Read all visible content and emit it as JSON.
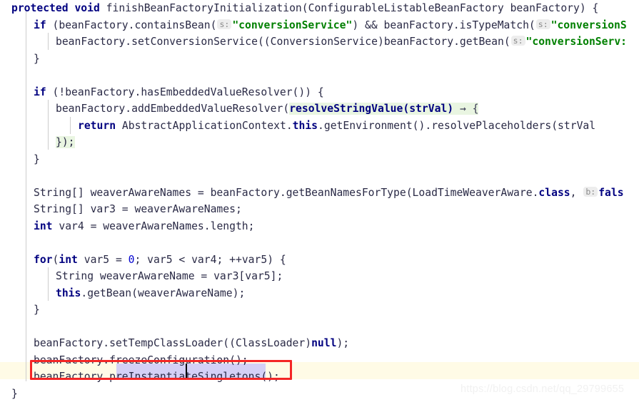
{
  "editor": {
    "language": "java",
    "colors": {
      "background": "#ffffff",
      "plain_text": "#2a2a46",
      "keyword": "#000080",
      "string": "#008000",
      "number": "#0000d0",
      "hint_text": "#8a8a8a",
      "hint_background": "#ededed",
      "lambda_highlight": "#e9f5e1",
      "current_line_highlight": "#fffbe6",
      "selection": "#d4d0f6",
      "indent_guide": "#cdcdcd",
      "annotation_border": "#f42626",
      "watermark": "#f1f1f1"
    },
    "lines": [
      {
        "n": 1,
        "indent": 0,
        "tokens": [
          {
            "t": "protected",
            "c": "kw"
          },
          {
            "t": " ",
            "c": "plain"
          },
          {
            "t": "void",
            "c": "kw"
          },
          {
            "t": " finishBeanFactoryInitialization(ConfigurableListableBeanFactory beanFactory) {",
            "c": "plain"
          }
        ]
      },
      {
        "n": 2,
        "indent": 1,
        "tokens": [
          {
            "t": "if",
            "c": "kw"
          },
          {
            "t": " (beanFactory.containsBean(",
            "c": "plain"
          },
          {
            "t": "s:",
            "c": "hint"
          },
          {
            "t": "\"conversionService\"",
            "c": "str"
          },
          {
            "t": ") && beanFactory.isTypeMatch(",
            "c": "plain"
          },
          {
            "t": "s:",
            "c": "hint"
          },
          {
            "t": "\"conversionS",
            "c": "str"
          }
        ]
      },
      {
        "n": 3,
        "indent": 2,
        "tokens": [
          {
            "t": "beanFactory.setConversionService((ConversionService)beanFactory.getBean(",
            "c": "plain"
          },
          {
            "t": "s:",
            "c": "hint"
          },
          {
            "t": "\"conversionServ:",
            "c": "str"
          }
        ]
      },
      {
        "n": 4,
        "indent": 1,
        "tokens": [
          {
            "t": "}",
            "c": "plain"
          }
        ]
      },
      {
        "n": 5,
        "indent": 0,
        "tokens": []
      },
      {
        "n": 6,
        "indent": 1,
        "tokens": [
          {
            "t": "if",
            "c": "kw"
          },
          {
            "t": " (!beanFactory.hasEmbeddedValueResolver()) {",
            "c": "plain"
          }
        ]
      },
      {
        "n": 7,
        "indent": 2,
        "tokens": [
          {
            "t": "beanFactory.addEmbeddedValueResolver(",
            "c": "plain"
          },
          {
            "t": "resolveStringValue(strVal)",
            "c": "lambda-sig"
          },
          {
            "t": " → {",
            "c": "lambda-arrow"
          }
        ]
      },
      {
        "n": 8,
        "indent": 3,
        "tokens": [
          {
            "t": "return",
            "c": "kw"
          },
          {
            "t": " AbstractApplicationContext.",
            "c": "plain"
          },
          {
            "t": "this",
            "c": "kw"
          },
          {
            "t": ".getEnvironment().resolvePlaceholders(strVal",
            "c": "plain"
          }
        ]
      },
      {
        "n": 9,
        "indent": 2,
        "tokens": [
          {
            "t": "});",
            "c": "lambda-close"
          }
        ]
      },
      {
        "n": 10,
        "indent": 1,
        "tokens": [
          {
            "t": "}",
            "c": "plain"
          }
        ]
      },
      {
        "n": 11,
        "indent": 0,
        "tokens": []
      },
      {
        "n": 12,
        "indent": 1,
        "tokens": [
          {
            "t": "String[] weaverAwareNames = beanFactory.getBeanNamesForType(LoadTimeWeaverAware.",
            "c": "plain"
          },
          {
            "t": "class",
            "c": "kw"
          },
          {
            "t": ", ",
            "c": "plain"
          },
          {
            "t": "b:",
            "c": "hint"
          },
          {
            "t": "fals",
            "c": "kw"
          }
        ]
      },
      {
        "n": 13,
        "indent": 1,
        "tokens": [
          {
            "t": "String[] var3 = weaverAwareNames;",
            "c": "plain"
          }
        ]
      },
      {
        "n": 14,
        "indent": 1,
        "tokens": [
          {
            "t": "int",
            "c": "kw"
          },
          {
            "t": " var4 = weaverAwareNames.length;",
            "c": "plain"
          }
        ]
      },
      {
        "n": 15,
        "indent": 0,
        "tokens": []
      },
      {
        "n": 16,
        "indent": 1,
        "tokens": [
          {
            "t": "for",
            "c": "kw"
          },
          {
            "t": "(",
            "c": "plain"
          },
          {
            "t": "int",
            "c": "kw"
          },
          {
            "t": " var5 = ",
            "c": "plain"
          },
          {
            "t": "0",
            "c": "num"
          },
          {
            "t": "; var5 < var4; ++var5) {",
            "c": "plain"
          }
        ]
      },
      {
        "n": 17,
        "indent": 2,
        "tokens": [
          {
            "t": "String weaverAwareName = var3[var5];",
            "c": "plain"
          }
        ]
      },
      {
        "n": 18,
        "indent": 2,
        "tokens": [
          {
            "t": "this",
            "c": "kw"
          },
          {
            "t": ".getBean(weaverAwareName);",
            "c": "plain"
          }
        ]
      },
      {
        "n": 19,
        "indent": 1,
        "tokens": [
          {
            "t": "}",
            "c": "plain"
          }
        ]
      },
      {
        "n": 20,
        "indent": 0,
        "tokens": []
      },
      {
        "n": 21,
        "indent": 1,
        "tokens": [
          {
            "t": "beanFactory.setTempClassLoader((ClassLoader)",
            "c": "plain"
          },
          {
            "t": "null",
            "c": "kw"
          },
          {
            "t": ");",
            "c": "plain"
          }
        ]
      },
      {
        "n": 22,
        "indent": 1,
        "tokens": [
          {
            "t": "beanFactory.freezeConfiguration();",
            "c": "plain"
          }
        ]
      },
      {
        "n": 23,
        "indent": 1,
        "current": true,
        "tokens": [
          {
            "t": "beanFactory.preInstantiateSingletons();",
            "c": "plain"
          }
        ]
      },
      {
        "n": 24,
        "indent": 0,
        "tokens": [
          {
            "t": "}",
            "c": "plain"
          }
        ]
      }
    ],
    "selection": {
      "text": "preInstantiateSingletons",
      "line": 23
    },
    "caret": {
      "line": 23,
      "after_text": "beanFactory.preInstantia"
    },
    "annotation": {
      "shape": "rectangle",
      "color": "#f42626",
      "target_text": "beanFactory.preInstantiateSingletons();"
    },
    "watermark": {
      "text": "https://blog.csdn.net/qq_29799655"
    }
  }
}
